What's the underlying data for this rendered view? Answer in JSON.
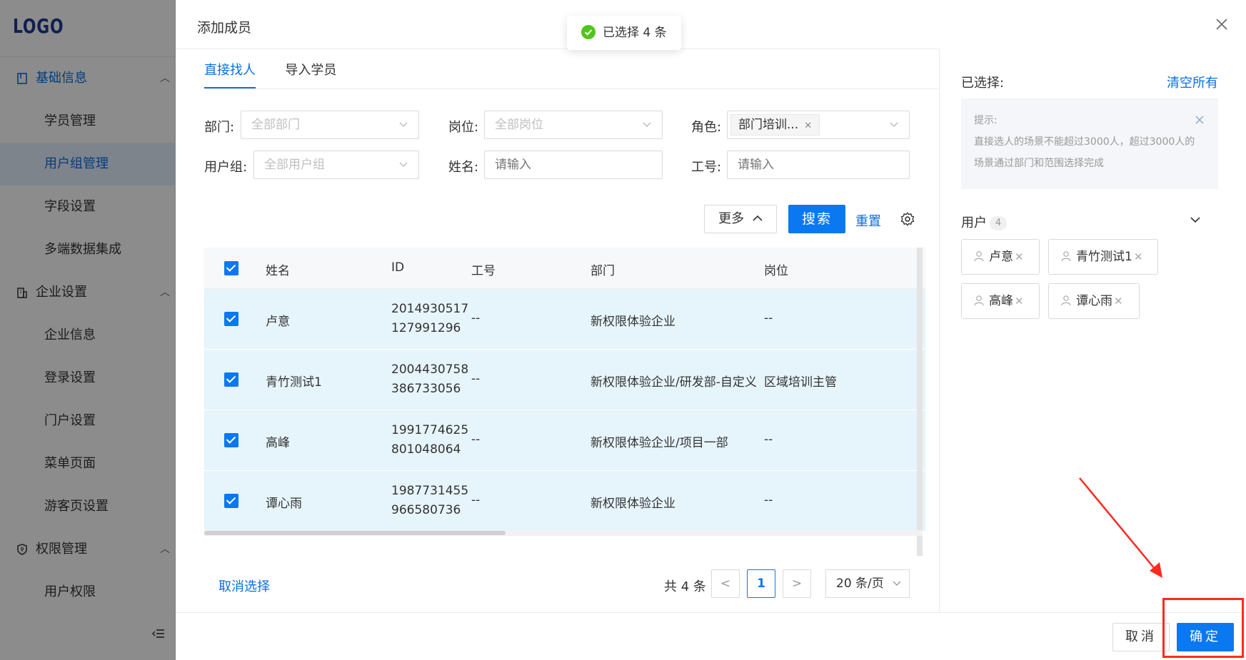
{
  "sidebar": {
    "logo": "LOGO",
    "groups": [
      {
        "label": "基础信息",
        "items": [
          "学员管理",
          "用户组管理",
          "字段设置",
          "多端数据集成"
        ]
      },
      {
        "label": "企业设置",
        "items": [
          "企业信息",
          "登录设置",
          "门户设置",
          "菜单页面",
          "游客页设置"
        ]
      },
      {
        "label": "权限管理",
        "items": [
          "用户权限"
        ]
      }
    ],
    "active_item": "用户组管理"
  },
  "toast": {
    "text": "已选择 4 条",
    "color": "#52c41a"
  },
  "modal": {
    "title": "添加成员",
    "tabs": [
      {
        "label": "直接找人",
        "active": true
      },
      {
        "label": "导入学员",
        "active": false
      }
    ],
    "filters": {
      "dept": {
        "label": "部门:",
        "placeholder": "全部部门"
      },
      "position": {
        "label": "岗位:",
        "placeholder": "全部岗位"
      },
      "role": {
        "label": "角色:",
        "tag": "部门培训..."
      },
      "user_group": {
        "label": "用户组:",
        "placeholder": "全部用户组"
      },
      "name": {
        "label": "姓名:",
        "placeholder": "请输入"
      },
      "employee_no": {
        "label": "工号:",
        "placeholder": "请输入"
      }
    },
    "actions": {
      "more": "更多",
      "search": "搜索",
      "reset": "重置"
    },
    "table": {
      "columns": [
        "姓名",
        "ID",
        "工号",
        "部门",
        "岗位"
      ],
      "rows": [
        {
          "name": "卢意",
          "id": "2014930517127991296",
          "no": "--",
          "dept": "新权限体验企业",
          "pos": "--"
        },
        {
          "name": "青竹测试1",
          "id": "2004430758386733056",
          "no": "--",
          "dept": "新权限体验企业/研发部-自定义",
          "pos": "区域培训主管"
        },
        {
          "name": "高峰",
          "id": "1991774625801048064",
          "no": "--",
          "dept": "新权限体验企业/项目一部",
          "pos": "--"
        },
        {
          "name": "谭心雨",
          "id": "1987731455966580736",
          "no": "--",
          "dept": "新权限体验企业",
          "pos": "--"
        }
      ]
    },
    "pagination": {
      "cancel_select": "取消选择",
      "total": "共 4 条",
      "prev": "<",
      "page": "1",
      "next": ">",
      "page_size": "20 条/页"
    },
    "right_panel": {
      "selected_label": "已选择:",
      "clear_all": "清空所有",
      "tip_title": "提示:",
      "tip_text": "直接选人的场景不能超过3000人，超过3000人的场景通过部门和范围选择完成",
      "users_label": "用户",
      "users_count": "4",
      "chips": [
        "卢意",
        "青竹测试1",
        "高峰",
        "谭心雨"
      ]
    },
    "footer": {
      "cancel": "取消",
      "ok": "确定"
    }
  },
  "accent": "#0a78f0",
  "annotation_color": "#ff2a1f"
}
